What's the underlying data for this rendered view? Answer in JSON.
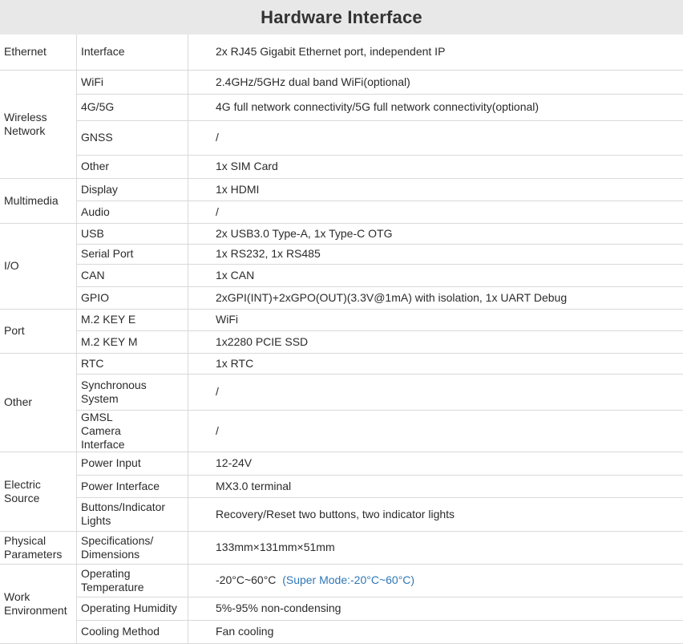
{
  "title": "Hardware Interface",
  "rows": [
    {
      "category": "Ethernet",
      "item": "Interface",
      "value": "2x RJ45 Gigabit Ethernet port, independent IP"
    },
    {
      "category": "Wireless Network",
      "item": "WiFi",
      "value": "2.4GHz/5GHz dual band WiFi(optional)"
    },
    {
      "category": "Wireless Network",
      "item": "4G/5G",
      "value": "4G full network connectivity/5G full network connectivity(optional)"
    },
    {
      "category": "Wireless Network",
      "item": "GNSS",
      "value": "/"
    },
    {
      "category": "Wireless Network",
      "item": "Other",
      "value": "1x SIM Card"
    },
    {
      "category": "Multimedia",
      "item": "Display",
      "value": "1x HDMI"
    },
    {
      "category": "Multimedia",
      "item": "Audio",
      "value": "/"
    },
    {
      "category": "I/O",
      "item": "USB",
      "value": "2x USB3.0 Type-A, 1x Type-C OTG"
    },
    {
      "category": "I/O",
      "item": "Serial Port",
      "value": "1x RS232, 1x RS485"
    },
    {
      "category": "I/O",
      "item": "CAN",
      "value": "1x CAN"
    },
    {
      "category": "I/O",
      "item": "GPIO",
      "value": "2xGPI(INT)+2xGPO(OUT)(3.3V@1mA) with isolation, 1x UART Debug"
    },
    {
      "category": "Port",
      "item": "M.2 KEY E",
      "value": "WiFi"
    },
    {
      "category": "Port",
      "item": "M.2 KEY M",
      "value": "1x2280 PCIE SSD"
    },
    {
      "category": "Other",
      "item": "RTC",
      "value": "1x RTC"
    },
    {
      "category": "Other",
      "item": "Synchronous System",
      "value": "/"
    },
    {
      "category": "Other",
      "item": "GMSL Camera Interface",
      "value": "/"
    },
    {
      "category": "Electric Source",
      "item": "Power Input",
      "value": "12-24V"
    },
    {
      "category": "Electric Source",
      "item": "Power Interface",
      "value": "MX3.0 terminal"
    },
    {
      "category": "Electric Source",
      "item": "Buttons/Indicator Lights",
      "value": "Recovery/Reset two buttons, two indicator lights"
    },
    {
      "category": "Physical Parameters",
      "item": "Specifications/ Dimensions",
      "value": "133mm×131mm×51mm"
    },
    {
      "category": "Work Environment",
      "item": "Operating Temperature",
      "value": "-20°C~60°C",
      "note": "(Super Mode:-20°C~60°C)"
    },
    {
      "category": "Work Environment",
      "item": "Operating Humidity",
      "value": "5%-95% non-condensing"
    },
    {
      "category": "Work Environment",
      "item": "Cooling Method",
      "value": "Fan cooling"
    }
  ],
  "colors": {
    "title_background": "#e8e8e8",
    "border": "#d9d9d9",
    "note_text": "#2f77b8"
  }
}
